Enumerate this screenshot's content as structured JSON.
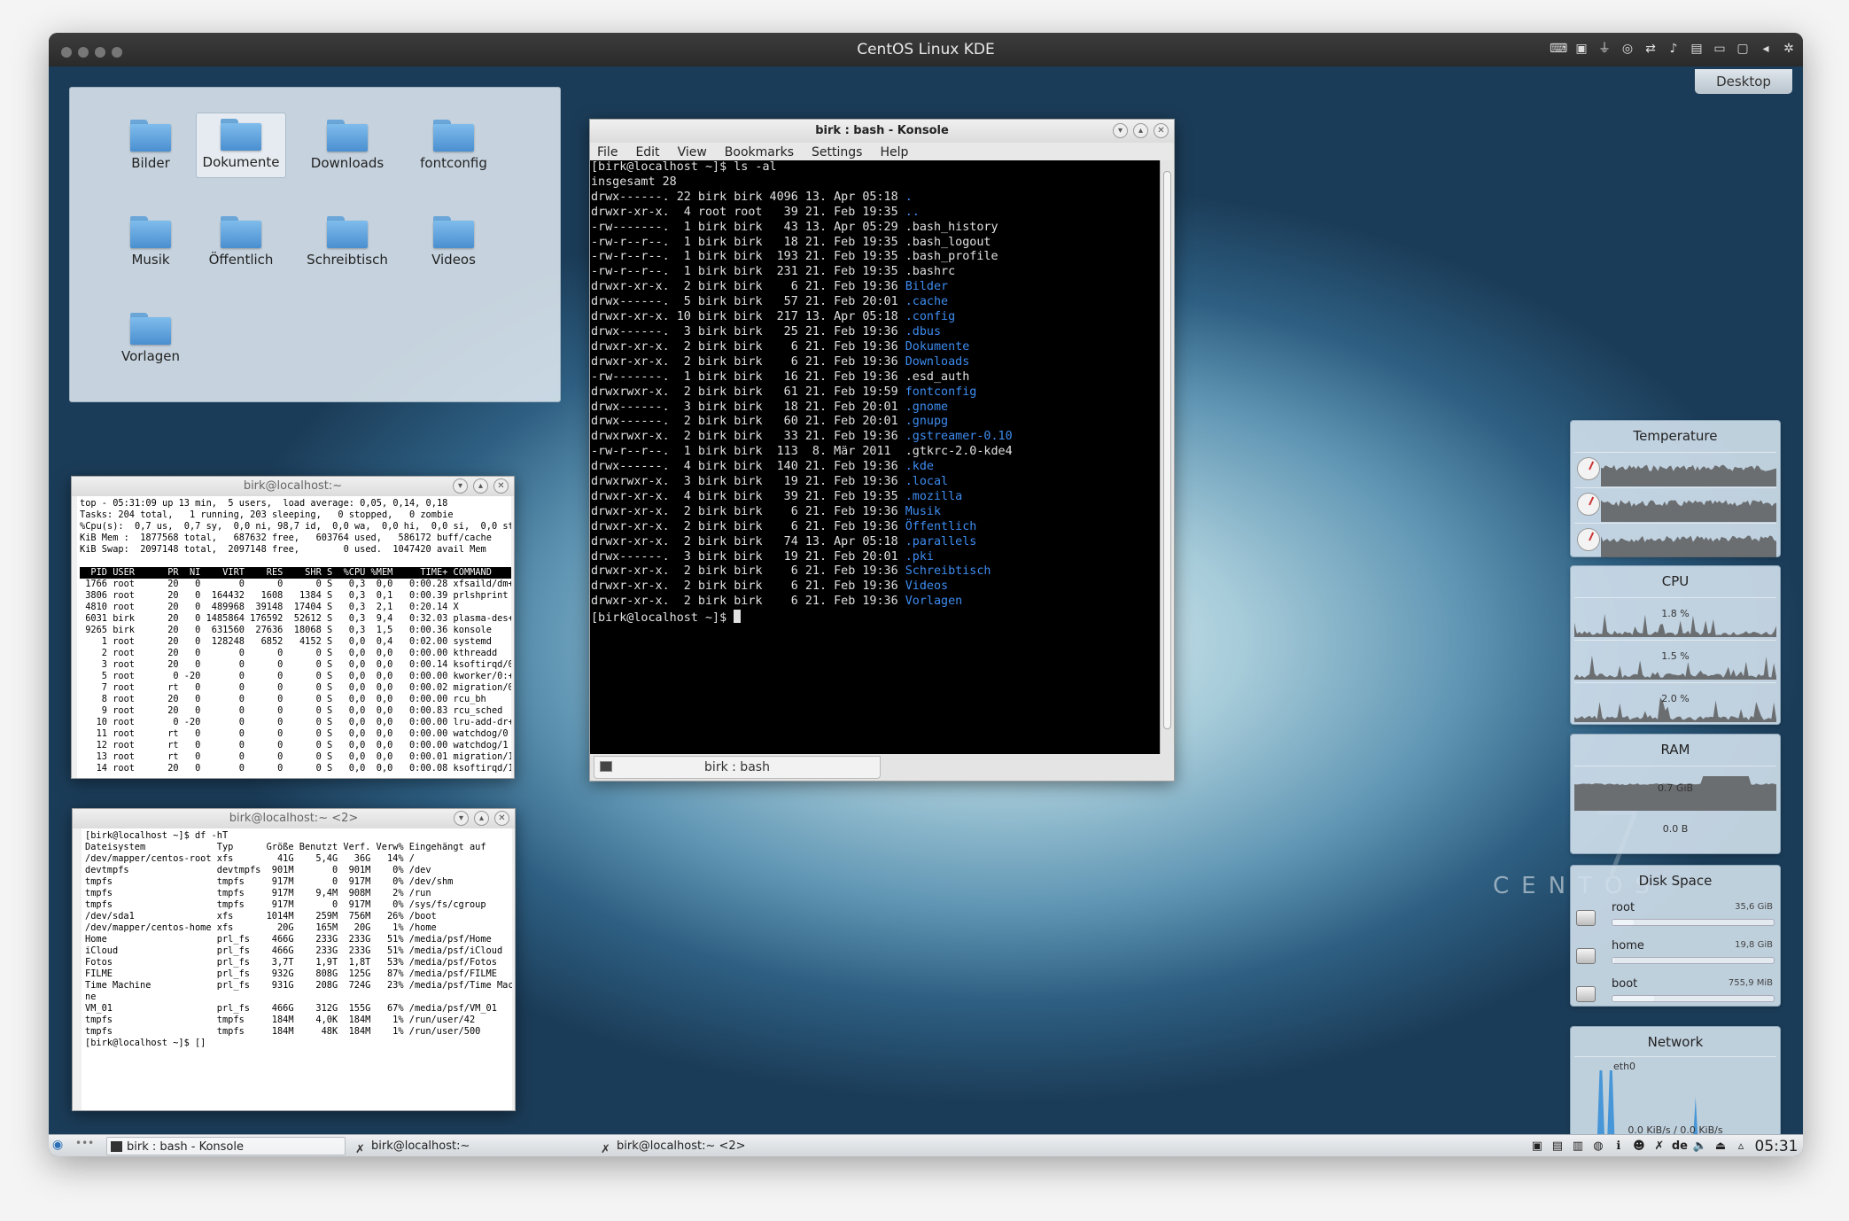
{
  "window_title": "CentOS Linux KDE",
  "desktop_button": "Desktop",
  "folders": [
    "Bilder",
    "Dokumente",
    "Downloads",
    "fontconfig",
    "Musik",
    "Öffentlich",
    "Schreibtisch",
    "Videos",
    "Vorlagen"
  ],
  "konsole": {
    "title": "birk : bash - Konsole",
    "menu": [
      "File",
      "Edit",
      "View",
      "Bookmarks",
      "Settings",
      "Help"
    ],
    "tab_label": "birk : bash",
    "lines": [
      {
        "t": "[birk@localhost ~]$ ls -al"
      },
      {
        "t": "insgesamt 28"
      },
      {
        "t": "drwx------. 22 birk birk 4096 13. Apr 05:18 ",
        "b": "."
      },
      {
        "t": "drwxr-xr-x.  4 root root   39 21. Feb 19:35 ",
        "b": ".."
      },
      {
        "t": "-rw-------.  1 birk birk   43 13. Apr 05:29 .bash_history"
      },
      {
        "t": "-rw-r--r--.  1 birk birk   18 21. Feb 19:35 .bash_logout"
      },
      {
        "t": "-rw-r--r--.  1 birk birk  193 21. Feb 19:35 .bash_profile"
      },
      {
        "t": "-rw-r--r--.  1 birk birk  231 21. Feb 19:35 .bashrc"
      },
      {
        "t": "drwxr-xr-x.  2 birk birk    6 21. Feb 19:36 ",
        "b": "Bilder"
      },
      {
        "t": "drwx------.  5 birk birk   57 21. Feb 20:01 ",
        "b": ".cache"
      },
      {
        "t": "drwxr-xr-x. 10 birk birk  217 13. Apr 05:18 ",
        "b": ".config"
      },
      {
        "t": "drwx------.  3 birk birk   25 21. Feb 19:36 ",
        "b": ".dbus"
      },
      {
        "t": "drwxr-xr-x.  2 birk birk    6 21. Feb 19:36 ",
        "b": "Dokumente"
      },
      {
        "t": "drwxr-xr-x.  2 birk birk    6 21. Feb 19:36 ",
        "b": "Downloads"
      },
      {
        "t": "-rw-------.  1 birk birk   16 21. Feb 19:36 .esd_auth"
      },
      {
        "t": "drwxrwxr-x.  2 birk birk   61 21. Feb 19:59 ",
        "b": "fontconfig"
      },
      {
        "t": "drwx------.  3 birk birk   18 21. Feb 20:01 ",
        "b": ".gnome"
      },
      {
        "t": "drwx------.  2 birk birk   60 21. Feb 20:01 ",
        "b": ".gnupg"
      },
      {
        "t": "drwxrwxr-x.  2 birk birk   33 21. Feb 19:36 ",
        "b": ".gstreamer-0.10"
      },
      {
        "t": "-rw-r--r--.  1 birk birk  113  8. Mär 2011  .gtkrc-2.0-kde4"
      },
      {
        "t": "drwx------.  4 birk birk  140 21. Feb 19:36 ",
        "b": ".kde"
      },
      {
        "t": "drwxrwxr-x.  3 birk birk   19 21. Feb 19:36 ",
        "b": ".local"
      },
      {
        "t": "drwxr-xr-x.  4 birk birk   39 21. Feb 19:35 ",
        "b": ".mozilla"
      },
      {
        "t": "drwxr-xr-x.  2 birk birk    6 21. Feb 19:36 ",
        "b": "Musik"
      },
      {
        "t": "drwxr-xr-x.  2 birk birk    6 21. Feb 19:36 ",
        "b": "Öffentlich"
      },
      {
        "t": "drwxr-xr-x.  2 birk birk   74 13. Apr 05:18 ",
        "b": ".parallels"
      },
      {
        "t": "drwx------.  3 birk birk   19 21. Feb 20:01 ",
        "b": ".pki"
      },
      {
        "t": "drwxr-xr-x.  2 birk birk    6 21. Feb 19:36 ",
        "b": "Schreibtisch"
      },
      {
        "t": "drwxr-xr-x.  2 birk birk    6 21. Feb 19:36 ",
        "b": "Videos"
      },
      {
        "t": "drwxr-xr-x.  2 birk birk    6 21. Feb 19:36 ",
        "b": "Vorlagen"
      },
      {
        "t": "[birk@localhost ~]$ ",
        "cursor": true
      }
    ]
  },
  "top_window": {
    "title": "birk@localhost:~",
    "summary": [
      "top - 05:31:09 up 13 min,  5 users,  load average: 0,05, 0,14, 0,18",
      "Tasks: 204 total,   1 running, 203 sleeping,   0 stopped,   0 zombie",
      "%Cpu(s):  0,7 us,  0,7 sy,  0,0 ni, 98,7 id,  0,0 wa,  0,0 hi,  0,0 si,  0,0 st",
      "KiB Mem :  1877568 total,   687632 free,   603764 used,   586172 buff/cache",
      "KiB Swap:  2097148 total,  2097148 free,        0 used.  1047420 avail Mem"
    ],
    "header": "  PID USER      PR  NI    VIRT    RES    SHR S  %CPU %MEM     TIME+ COMMAND      ",
    "rows": [
      " 1766 root      20   0       0      0      0 S   0,3  0,0   0:00.28 xfsaild/dm+",
      " 3806 root      20   0  164432   1608   1384 S   0,3  0,1   0:00.39 prlshprint",
      " 4810 root      20   0  489968  39148  17404 S   0,3  2,1   0:20.14 X",
      " 6031 birk      20   0 1485864 176592  52612 S   0,3  9,4   0:32.03 plasma-des+",
      " 9265 birk      20   0  631560  27636  18068 S   0,3  1,5   0:00.36 konsole",
      "    1 root      20   0  128248   6852   4152 S   0,0  0,4   0:02.00 systemd",
      "    2 root      20   0       0      0      0 S   0,0  0,0   0:00.00 kthreadd",
      "    3 root      20   0       0      0      0 S   0,0  0,0   0:00.14 ksoftirqd/0",
      "    5 root       0 -20       0      0      0 S   0,0  0,0   0:00.00 kworker/0:+",
      "    7 root      rt   0       0      0      0 S   0,0  0,0   0:00.02 migration/0",
      "    8 root      20   0       0      0      0 S   0,0  0,0   0:00.00 rcu_bh",
      "    9 root      20   0       0      0      0 S   0,0  0,0   0:00.83 rcu_sched",
      "   10 root       0 -20       0      0      0 S   0,0  0,0   0:00.00 lru-add-dr+",
      "   11 root      rt   0       0      0      0 S   0,0  0,0   0:00.00 watchdog/0",
      "   12 root      rt   0       0      0      0 S   0,0  0,0   0:00.00 watchdog/1",
      "   13 root      rt   0       0      0      0 S   0,0  0,0   0:00.01 migration/1",
      "   14 root      20   0       0      0      0 S   0,0  0,0   0:00.08 ksoftirqd/1"
    ]
  },
  "df_window": {
    "title": "birk@localhost:~ <2>",
    "lines": [
      "[birk@localhost ~]$ df -hT",
      "Dateisystem             Typ      Größe Benutzt Verf. Verw% Eingehängt auf",
      "/dev/mapper/centos-root xfs        41G    5,4G   36G   14% /",
      "devtmpfs                devtmpfs  901M       0  901M    0% /dev",
      "tmpfs                   tmpfs     917M       0  917M    0% /dev/shm",
      "tmpfs                   tmpfs     917M    9,4M  908M    2% /run",
      "tmpfs                   tmpfs     917M       0  917M    0% /sys/fs/cgroup",
      "/dev/sda1               xfs      1014M    259M  756M   26% /boot",
      "/dev/mapper/centos-home xfs        20G    165M   20G    1% /home",
      "Home                    prl_fs    466G    233G  233G   51% /media/psf/Home",
      "iCloud                  prl_fs    466G    233G  233G   51% /media/psf/iCloud",
      "Fotos                   prl_fs    3,7T    1,9T  1,8T   53% /media/psf/Fotos",
      "FILME                   prl_fs    932G    808G  125G   87% /media/psf/FILME",
      "Time Machine            prl_fs    931G    208G  724G   23% /media/psf/Time Machi",
      "ne",
      "VM_01                   prl_fs    466G    312G  155G   67% /media/psf/VM_01",
      "tmpfs                   tmpfs     184M    4,0K  184M    1% /run/user/42",
      "tmpfs                   tmpfs     184M     48K  184M    1% /run/user/500",
      "[birk@localhost ~]$ []"
    ]
  },
  "widgets": {
    "temperature": {
      "title": "Temperature"
    },
    "cpu": {
      "title": "CPU",
      "values": [
        "1.8 %",
        "1.5 %",
        "2.0 %"
      ]
    },
    "ram": {
      "title": "RAM",
      "values": [
        "0.7 GiB",
        "0.0 B"
      ]
    },
    "disk": {
      "title": "Disk Space",
      "items": [
        {
          "name": "root",
          "size": "35,6 GiB",
          "used_fraction": 0.13
        },
        {
          "name": "home",
          "size": "19,8 GiB",
          "used_fraction": 0.01
        },
        {
          "name": "boot",
          "size": "755,9 MiB",
          "used_fraction": 0.26
        }
      ]
    },
    "network": {
      "title": "Network",
      "iface": "eth0",
      "rate": "0.0 KiB/s / 0.0 KiB/s"
    }
  },
  "branding": {
    "big": "7",
    "small": "CENTOS"
  },
  "taskbar": {
    "tasks": [
      "birk : bash - Konsole",
      "birk@localhost:~",
      "birk@localhost:~ <2>"
    ],
    "keyboard": "de",
    "clock": "05:31"
  }
}
